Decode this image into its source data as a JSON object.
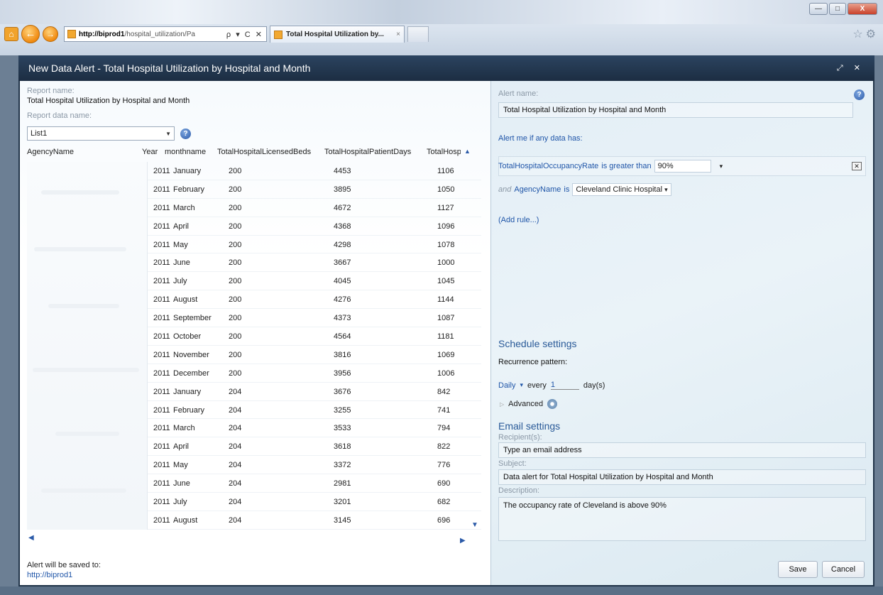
{
  "browser": {
    "url_host": "http://biprod1",
    "url_path": "/hospital_utilization/Pa",
    "address_tools": "ρ ▾ C ✕",
    "tab_title": "Total Hospital Utilization by...",
    "tab_close": "×",
    "back_glyph": "←",
    "forward_glyph": "→",
    "right_icons": "☆⚙",
    "win_min": "—",
    "win_max": "□",
    "win_close": "X"
  },
  "dialog": {
    "title": "New Data Alert - Total Hospital Utilization by Hospital and Month",
    "controls": "⤢ ✕"
  },
  "left": {
    "report_name_label": "Report name:",
    "report_name": "Total Hospital Utilization by Hospital and Month",
    "report_data_label": "Report data name:",
    "report_data_value": "List1",
    "dropdown_arrow": "▼",
    "help_glyph": "?",
    "columns": {
      "agency": "AgencyName",
      "year": "Year",
      "month": "monthname",
      "beds": "TotalHospitalLicensedBeds",
      "days": "TotalHospitalPatientDays",
      "tot": "TotalHosp"
    },
    "scroll_up": "▲",
    "scroll_down": "▼",
    "scroll_left": "◀",
    "scroll_right": "▶",
    "rows": [
      {
        "year": "2011",
        "month": "January",
        "beds": "200",
        "days": "4453",
        "tot": "1106"
      },
      {
        "year": "2011",
        "month": "February",
        "beds": "200",
        "days": "3895",
        "tot": "1050"
      },
      {
        "year": "2011",
        "month": "March",
        "beds": "200",
        "days": "4672",
        "tot": "1127"
      },
      {
        "year": "2011",
        "month": "April",
        "beds": "200",
        "days": "4368",
        "tot": "1096"
      },
      {
        "year": "2011",
        "month": "May",
        "beds": "200",
        "days": "4298",
        "tot": "1078"
      },
      {
        "year": "2011",
        "month": "June",
        "beds": "200",
        "days": "3667",
        "tot": "1000"
      },
      {
        "year": "2011",
        "month": "July",
        "beds": "200",
        "days": "4045",
        "tot": "1045"
      },
      {
        "year": "2011",
        "month": "August",
        "beds": "200",
        "days": "4276",
        "tot": "1144"
      },
      {
        "year": "2011",
        "month": "September",
        "beds": "200",
        "days": "4373",
        "tot": "1087"
      },
      {
        "year": "2011",
        "month": "October",
        "beds": "200",
        "days": "4564",
        "tot": "1181"
      },
      {
        "year": "2011",
        "month": "November",
        "beds": "200",
        "days": "3816",
        "tot": "1069"
      },
      {
        "year": "2011",
        "month": "December",
        "beds": "200",
        "days": "3956",
        "tot": "1006"
      },
      {
        "year": "2011",
        "month": "January",
        "beds": "204",
        "days": "3676",
        "tot": "842"
      },
      {
        "year": "2011",
        "month": "February",
        "beds": "204",
        "days": "3255",
        "tot": "741"
      },
      {
        "year": "2011",
        "month": "March",
        "beds": "204",
        "days": "3533",
        "tot": "794"
      },
      {
        "year": "2011",
        "month": "April",
        "beds": "204",
        "days": "3618",
        "tot": "822"
      },
      {
        "year": "2011",
        "month": "May",
        "beds": "204",
        "days": "3372",
        "tot": "776"
      },
      {
        "year": "2011",
        "month": "June",
        "beds": "204",
        "days": "2981",
        "tot": "690"
      },
      {
        "year": "2011",
        "month": "July",
        "beds": "204",
        "days": "3201",
        "tot": "682"
      },
      {
        "year": "2011",
        "month": "August",
        "beds": "204",
        "days": "3145",
        "tot": "696"
      }
    ],
    "saved_label": "Alert will be saved to:",
    "saved_link": "http://biprod1"
  },
  "right": {
    "alert_name_label": "Alert name:",
    "alert_name": "Total Hospital Utilization by Hospital and Month",
    "help_glyph": "?",
    "alert_if": "Alert me if any data has:",
    "rule1_field": "TotalHospitalOccupancyRate",
    "rule1_op": "is greater than",
    "rule1_value": "90%",
    "rule1_arrow": "▾",
    "rule1_delete": "✕",
    "rule2_and": "and",
    "rule2_field": "AgencyName",
    "rule2_op": "is",
    "rule2_value": "Cleveland Clinic Hospital",
    "rule2_arrow": "▾",
    "add_rule": "(Add rule...)",
    "schedule_title": "Schedule settings",
    "recurrence_label": "Recurrence pattern:",
    "recurrence_value": "Daily",
    "recurrence_arrow": "▾",
    "every_label": "every",
    "every_value": "1",
    "every_unit": "day(s)",
    "advanced_arrow": "▷",
    "advanced_label": "Advanced",
    "email_title": "Email settings",
    "recipients_label": "Recipient(s):",
    "recipients_placeholder": "Type an email address",
    "subject_label": "Subject:",
    "subject_value": "Data alert for Total Hospital Utilization by Hospital and Month",
    "description_label": "Description:",
    "description_value": "The occupancy rate of Cleveland is above 90%",
    "save_label": "Save",
    "cancel_label": "Cancel"
  }
}
